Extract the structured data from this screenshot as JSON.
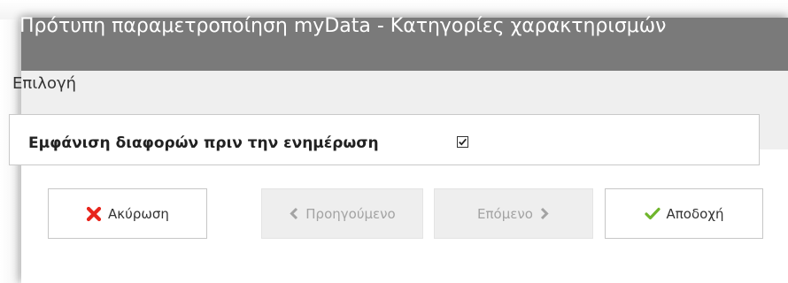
{
  "dialog": {
    "title": "Πρότυπη παραμετροποίηση myData - Κατηγορίες χαρακτηρισμών",
    "section_title": "Επιλογή",
    "option": {
      "label": "Εμφάνιση διαφορών πριν την ενημέρωση",
      "checked": true
    }
  },
  "buttons": {
    "cancel": {
      "label": "Ακύρωση",
      "icon": "close-icon",
      "color": "#e8251c"
    },
    "previous": {
      "label": "Προηγούμενο",
      "icon": "chevron-left-icon",
      "enabled": false
    },
    "next": {
      "label": "Επόμενο",
      "icon": "chevron-right-icon",
      "enabled": false
    },
    "accept": {
      "label": "Αποδοχή",
      "icon": "check-icon",
      "color": "#6fb52c"
    }
  },
  "colors": {
    "titlebar": "#7a7a7a",
    "section_background": "#efefef",
    "disabled_text": "#a3a3a3"
  }
}
